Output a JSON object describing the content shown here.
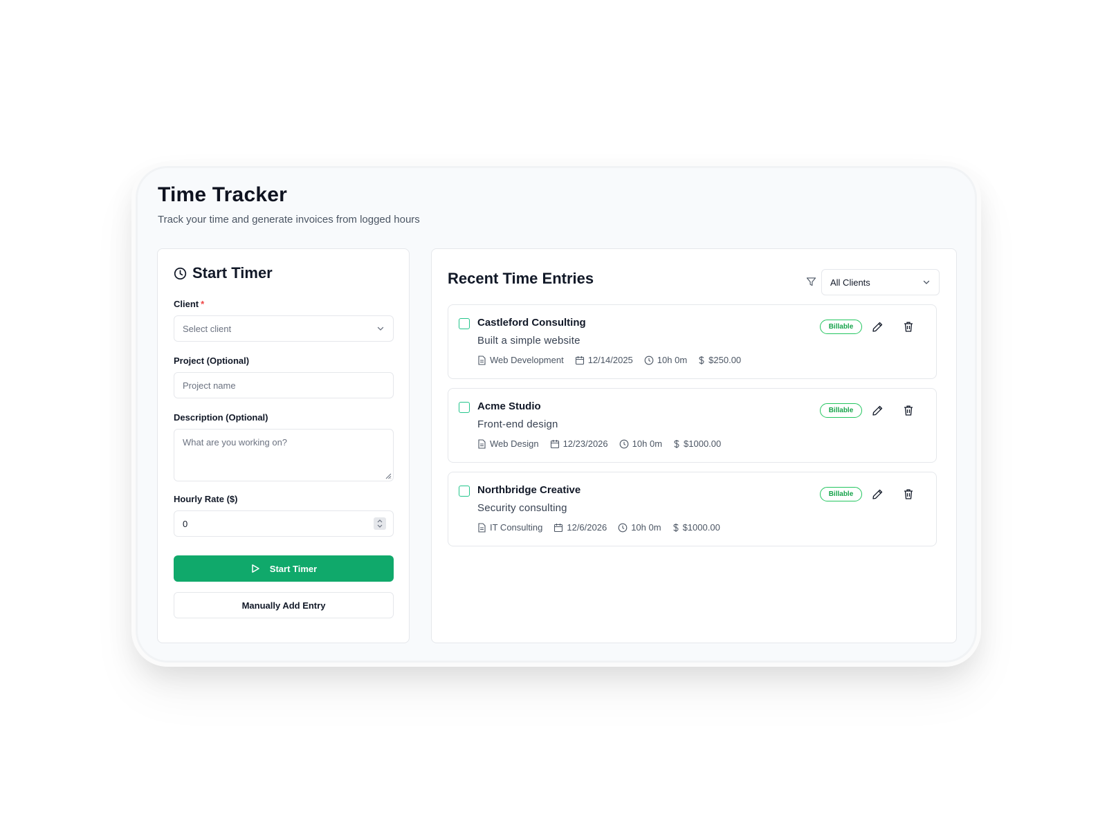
{
  "header": {
    "title": "Time Tracker",
    "subtitle": "Track your time and generate invoices from logged hours"
  },
  "timer_form": {
    "title": "Start Timer",
    "client_label": "Client",
    "client_required_mark": "*",
    "client_placeholder": "Select client",
    "project_label": "Project (Optional)",
    "project_placeholder": "Project name",
    "description_label": "Description (Optional)",
    "description_placeholder": "What are you working on?",
    "rate_label": "Hourly Rate ($)",
    "rate_value": "0",
    "start_button": "Start Timer",
    "manual_button": "Manually Add Entry"
  },
  "entries_panel": {
    "title": "Recent Time Entries",
    "filter_value": "All Clients",
    "entries": [
      {
        "client": "Castleford Consulting",
        "description": "Built a simple website",
        "project": "Web Development",
        "date": "12/14/2025",
        "duration": "10h 0m",
        "amount": "$250.00",
        "badge": "Billable"
      },
      {
        "client": "Acme Studio",
        "description": "Front-end design",
        "project": "Web Design",
        "date": "12/23/2026",
        "duration": "10h 0m",
        "amount": "$1000.00",
        "badge": "Billable"
      },
      {
        "client": "Northbridge Creative",
        "description": "Security consulting",
        "project": "IT Consulting",
        "date": "12/6/2026",
        "duration": "10h 0m",
        "amount": "$1000.00",
        "badge": "Billable"
      }
    ]
  },
  "colors": {
    "primary": "#10a96b",
    "billable": "#16a34a",
    "checkbox": "#22c58b",
    "required": "#ef4444"
  }
}
